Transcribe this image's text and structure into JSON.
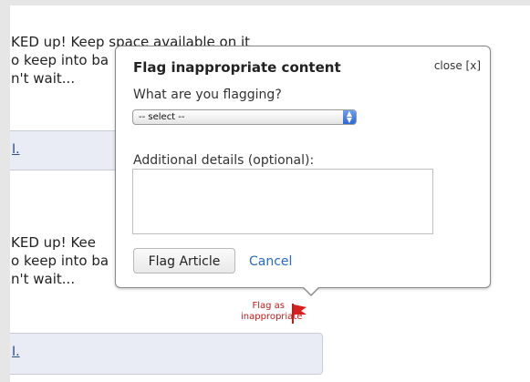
{
  "article": {
    "block1_lines": [
      "KED up! Keep space available on it",
      "o keep into ba",
      "n't wait..."
    ],
    "block2_lines": [
      "KED up! Kee",
      "o keep into ba",
      "n't wait..."
    ],
    "box_link": "I."
  },
  "popup": {
    "title": "Flag inappropriate content",
    "close_label": "close [x]",
    "question_label": "What are you flagging?",
    "select_value": "-- select --",
    "details_label": "Additional details (optional):",
    "details_value": "",
    "submit_label": "Flag Article",
    "cancel_label": "Cancel"
  },
  "flag_link": {
    "line1": "Flag as",
    "line2": "inappropriate",
    "icon": "red-flag-icon",
    "color": "#c11b1b"
  }
}
